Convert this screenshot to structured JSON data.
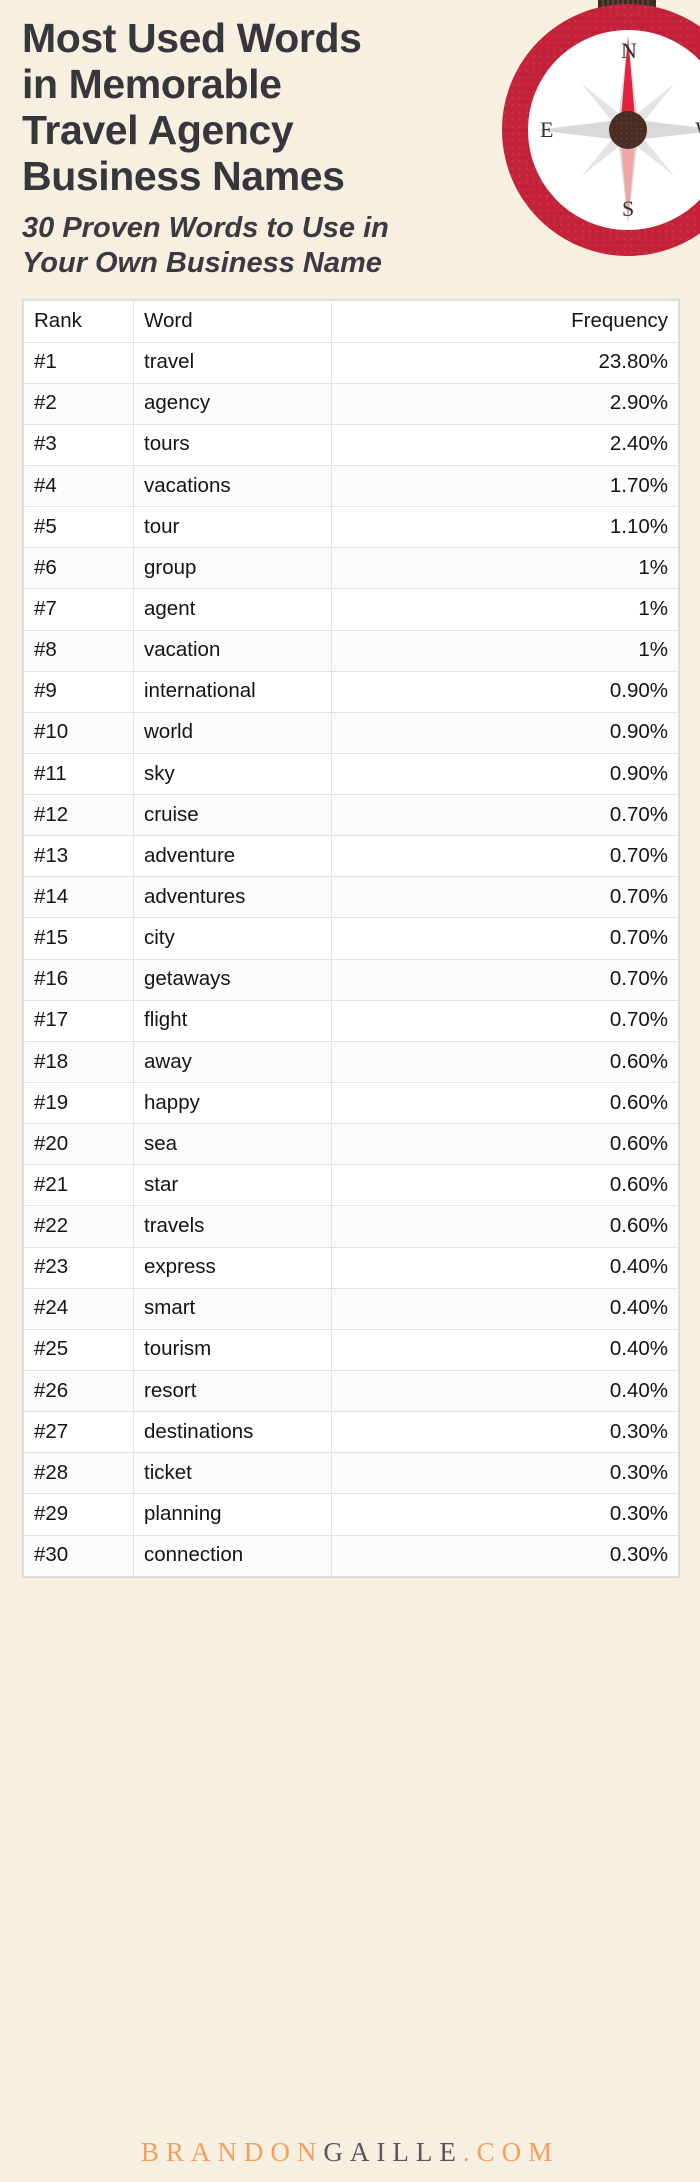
{
  "page": {
    "background_color": "#f7efdf",
    "title_lines": [
      "Most Used Words",
      "in Memorable",
      "Travel Agency",
      "Business Names"
    ],
    "subtitle_lines": [
      "30 Proven Words to Use in",
      "Your Own Business Name"
    ]
  },
  "graphic": {
    "name": "compass-illustration",
    "directions": {
      "north": "N",
      "east": "E",
      "south": "S",
      "west": "W"
    },
    "colors": {
      "ring": "#c4223a",
      "needle_north": "#e0243f",
      "needle_south": "#f0a6a6",
      "hub": "#4a2d22"
    }
  },
  "table": {
    "columns": [
      "Rank",
      "Word",
      "Frequency"
    ],
    "rows": [
      {
        "rank": "#1",
        "word": "travel",
        "frequency": "23.80%"
      },
      {
        "rank": "#2",
        "word": "agency",
        "frequency": "2.90%"
      },
      {
        "rank": "#3",
        "word": "tours",
        "frequency": "2.40%"
      },
      {
        "rank": "#4",
        "word": "vacations",
        "frequency": "1.70%"
      },
      {
        "rank": "#5",
        "word": "tour",
        "frequency": "1.10%"
      },
      {
        "rank": "#6",
        "word": "group",
        "frequency": "1%"
      },
      {
        "rank": "#7",
        "word": "agent",
        "frequency": "1%"
      },
      {
        "rank": "#8",
        "word": "vacation",
        "frequency": "1%"
      },
      {
        "rank": "#9",
        "word": "international",
        "frequency": "0.90%"
      },
      {
        "rank": "#10",
        "word": "world",
        "frequency": "0.90%"
      },
      {
        "rank": "#11",
        "word": "sky",
        "frequency": "0.90%"
      },
      {
        "rank": "#12",
        "word": "cruise",
        "frequency": "0.70%"
      },
      {
        "rank": "#13",
        "word": "adventure",
        "frequency": "0.70%"
      },
      {
        "rank": "#14",
        "word": "adventures",
        "frequency": "0.70%"
      },
      {
        "rank": "#15",
        "word": "city",
        "frequency": "0.70%"
      },
      {
        "rank": "#16",
        "word": "getaways",
        "frequency": "0.70%"
      },
      {
        "rank": "#17",
        "word": "flight",
        "frequency": "0.70%"
      },
      {
        "rank": "#18",
        "word": "away",
        "frequency": "0.60%"
      },
      {
        "rank": "#19",
        "word": "happy",
        "frequency": "0.60%"
      },
      {
        "rank": "#20",
        "word": "sea",
        "frequency": "0.60%"
      },
      {
        "rank": "#21",
        "word": "star",
        "frequency": "0.60%"
      },
      {
        "rank": "#22",
        "word": "travels",
        "frequency": "0.60%"
      },
      {
        "rank": "#23",
        "word": "express",
        "frequency": "0.40%"
      },
      {
        "rank": "#24",
        "word": "smart",
        "frequency": "0.40%"
      },
      {
        "rank": "#25",
        "word": "tourism",
        "frequency": "0.40%"
      },
      {
        "rank": "#26",
        "word": "resort",
        "frequency": "0.40%"
      },
      {
        "rank": "#27",
        "word": "destinations",
        "frequency": "0.30%"
      },
      {
        "rank": "#28",
        "word": "ticket",
        "frequency": "0.30%"
      },
      {
        "rank": "#29",
        "word": "planning",
        "frequency": "0.30%"
      },
      {
        "rank": "#30",
        "word": "connection",
        "frequency": "0.30%"
      }
    ]
  },
  "footer": {
    "brand_part_1": "BRANDON",
    "brand_part_2": "GAILLE",
    "brand_part_3": ".COM",
    "color_accent": "#f2a060",
    "color_dark": "#56565c"
  },
  "chart_data": {
    "type": "table",
    "title": "Most Used Words in Memorable Travel Agency Business Names",
    "subtitle": "30 Proven Words to Use in Your Own Business Name",
    "xlabel": "Word",
    "ylabel": "Frequency",
    "categories": [
      "travel",
      "agency",
      "tours",
      "vacations",
      "tour",
      "group",
      "agent",
      "vacation",
      "international",
      "world",
      "sky",
      "cruise",
      "adventure",
      "adventures",
      "city",
      "getaways",
      "flight",
      "away",
      "happy",
      "sea",
      "star",
      "travels",
      "express",
      "smart",
      "tourism",
      "resort",
      "destinations",
      "ticket",
      "planning",
      "connection"
    ],
    "values": [
      23.8,
      2.9,
      2.4,
      1.7,
      1.1,
      1.0,
      1.0,
      1.0,
      0.9,
      0.9,
      0.9,
      0.7,
      0.7,
      0.7,
      0.7,
      0.7,
      0.7,
      0.6,
      0.6,
      0.6,
      0.6,
      0.6,
      0.4,
      0.4,
      0.4,
      0.4,
      0.3,
      0.3,
      0.3,
      0.3
    ],
    "value_unit": "%",
    "ranks": [
      "#1",
      "#2",
      "#3",
      "#4",
      "#5",
      "#6",
      "#7",
      "#8",
      "#9",
      "#10",
      "#11",
      "#12",
      "#13",
      "#14",
      "#15",
      "#16",
      "#17",
      "#18",
      "#19",
      "#20",
      "#21",
      "#22",
      "#23",
      "#24",
      "#25",
      "#26",
      "#27",
      "#28",
      "#29",
      "#30"
    ],
    "legend": [],
    "grid": true
  }
}
